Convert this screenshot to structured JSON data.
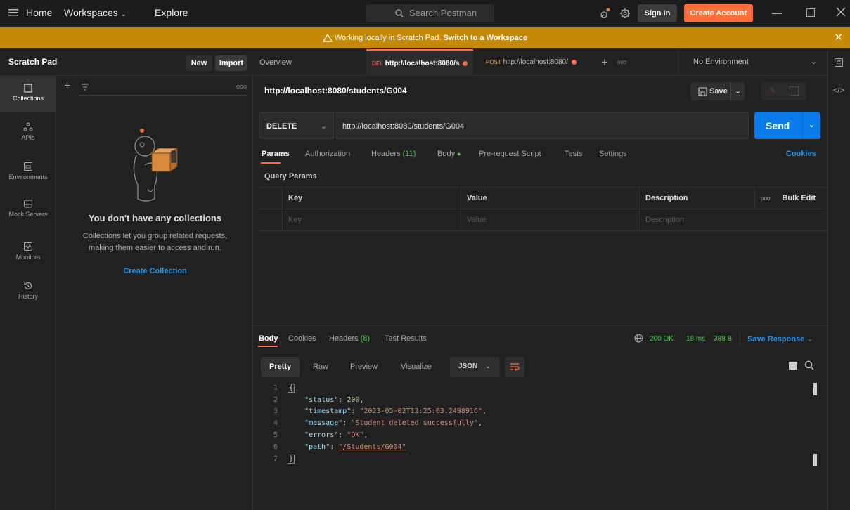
{
  "topbar": {
    "home": "Home",
    "workspaces": "Workspaces",
    "explore": "Explore",
    "search_placeholder": "Search Postman",
    "sign_in": "Sign In",
    "create_account": "Create Account"
  },
  "banner": {
    "text": "Working locally in Scratch Pad.",
    "link": "Switch to a Workspace"
  },
  "sidebar": {
    "title": "Scratch Pad",
    "new_label": "New",
    "import_label": "Import",
    "rail": [
      {
        "label": "Collections",
        "icon": "collections-icon"
      },
      {
        "label": "APIs",
        "icon": "apis-icon"
      },
      {
        "label": "Environments",
        "icon": "environments-icon"
      },
      {
        "label": "Mock Servers",
        "icon": "mock-servers-icon"
      },
      {
        "label": "Monitors",
        "icon": "monitors-icon"
      },
      {
        "label": "History",
        "icon": "history-icon"
      }
    ],
    "empty_title": "You don't have any collections",
    "empty_desc_1": "Collections let you group related requests,",
    "empty_desc_2": "making them easier to access and run.",
    "create_collection": "Create Collection"
  },
  "tabs": {
    "overview": "Overview",
    "tab1_method": "DEL",
    "tab1_url": "http://localhost:8080/s",
    "tab2_method": "POST",
    "tab2_url": "http://localhost:8080/",
    "environment": "No Environment"
  },
  "request": {
    "title": "http://localhost:8080/students/G004",
    "save_label": "Save",
    "method": "DELETE",
    "url": "http://localhost:8080/students/G004",
    "send_label": "Send",
    "tabs": {
      "params": "Params",
      "authorization": "Authorization",
      "headers": "Headers",
      "headers_count": "(11)",
      "body": "Body",
      "prerequest": "Pre-request Script",
      "tests": "Tests",
      "settings": "Settings",
      "cookies": "Cookies"
    },
    "query_params_label": "Query Params",
    "table": {
      "headers": [
        "Key",
        "Value",
        "Description"
      ],
      "bulk_edit": "Bulk Edit",
      "placeholders": [
        "Key",
        "Value",
        "Description"
      ]
    }
  },
  "response": {
    "tabs": {
      "body": "Body",
      "cookies": "Cookies",
      "headers": "Headers",
      "headers_count": "(8)",
      "test_results": "Test Results"
    },
    "status": "200 OK",
    "time": "18 ms",
    "size": "388 B",
    "save_response": "Save Response",
    "views": [
      "Pretty",
      "Raw",
      "Preview",
      "Visualize"
    ],
    "format": "JSON",
    "lines": [
      {
        "n": "1",
        "open": "{"
      },
      {
        "n": "2",
        "key": "\"status\"",
        "num": "200",
        "tail": ","
      },
      {
        "n": "3",
        "key": "\"timestamp\"",
        "str": "\"2023-05-02T12:25:03.2498916\"",
        "tail": ","
      },
      {
        "n": "4",
        "key": "\"message\"",
        "str": "\"Student deleted successfully\"",
        "tail": ","
      },
      {
        "n": "5",
        "key": "\"errors\"",
        "str": "\"OK\"",
        "tail": ","
      },
      {
        "n": "6",
        "key": "\"path\"",
        "str": "\"/Students/G004\"",
        "tail": ""
      },
      {
        "n": "7",
        "open": "}"
      }
    ]
  },
  "colors": {
    "accent_orange": "#ff6c37",
    "banner": "#c48906",
    "send_blue": "#097bed",
    "link_blue": "#2196f3",
    "status_green": "#49c24e"
  }
}
